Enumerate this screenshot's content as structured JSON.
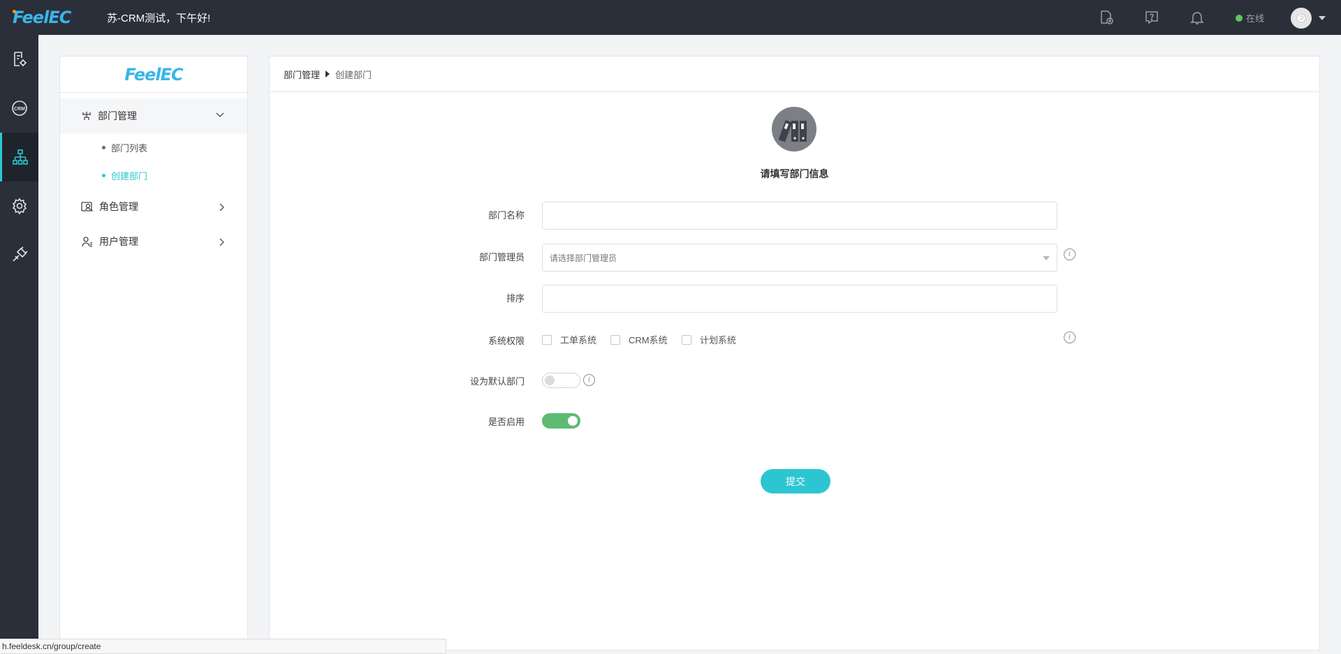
{
  "topbar": {
    "logo": "FeelEC",
    "greeting": "苏-CRM测试，下午好!",
    "status": "在线",
    "icons": [
      "new-doc-icon",
      "help-icon",
      "bell-icon"
    ]
  },
  "rail": {
    "items": [
      "report-settings-icon",
      "crm-icon",
      "org-chart-icon",
      "gear-icon",
      "plugin-icon"
    ],
    "active_index": 2
  },
  "sidebar": {
    "logo": "FeelEC",
    "groups": [
      {
        "label": "部门管理",
        "open": true,
        "items": [
          {
            "label": "部门列表",
            "active": false
          },
          {
            "label": "创建部门",
            "active": true
          }
        ]
      },
      {
        "label": "角色管理",
        "open": false
      },
      {
        "label": "用户管理",
        "open": false
      }
    ]
  },
  "breadcrumb": {
    "root": "部门管理",
    "current": "创建部门"
  },
  "form": {
    "title": "请填写部门信息",
    "name_label": "部门名称",
    "name_value": "",
    "manager_label": "部门管理员",
    "manager_placeholder": "请选择部门管理员",
    "sort_label": "排序",
    "sort_value": "",
    "perm_label": "系统权限",
    "perm_options": [
      {
        "label": "工单系统",
        "checked": false
      },
      {
        "label": "CRM系统",
        "checked": false
      },
      {
        "label": "计划系统",
        "checked": false
      }
    ],
    "default_label": "设为默认部门",
    "default_on": false,
    "enabled_label": "是否启用",
    "enabled_on": true,
    "submit_label": "提交"
  },
  "statusbar": {
    "url": "h.feeldesk.cn/group/create"
  },
  "colors": {
    "accent": "#2cc5d2",
    "topbar": "#2b2f3a",
    "toggle_on": "#5dbb73",
    "online": "#5ac85a"
  }
}
